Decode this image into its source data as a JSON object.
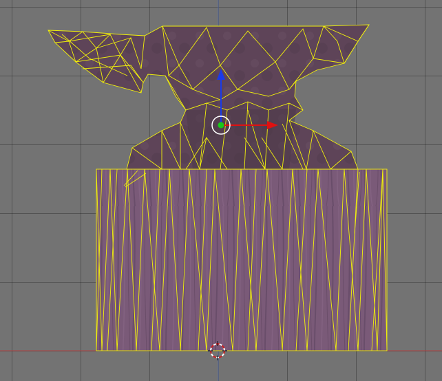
{
  "viewport": {
    "view": "front-orthographic",
    "background_color": "#737373",
    "grid_color": "#5a5a5a",
    "x_axis_color": "#b04040",
    "z_axis_color": "#5a6fa8"
  },
  "object": {
    "name": "",
    "mode": "edit",
    "parts": [
      "anvil",
      "wooden-stump"
    ],
    "wire_color": "#f2f20a",
    "anvil_texture_color": "#5e4458",
    "stump_texture_color": "#7a5a78"
  },
  "manipulator": {
    "type": "translate",
    "x_arrow_color": "#e01010",
    "z_arrow_color": "#1a3ae8",
    "pivot_color": "#18c818",
    "pivot_ring_color": "#ffffff"
  },
  "cursor_3d": {
    "icon": "3d-cursor-icon",
    "ring_colors": [
      "#d02020",
      "#ffffff"
    ]
  }
}
